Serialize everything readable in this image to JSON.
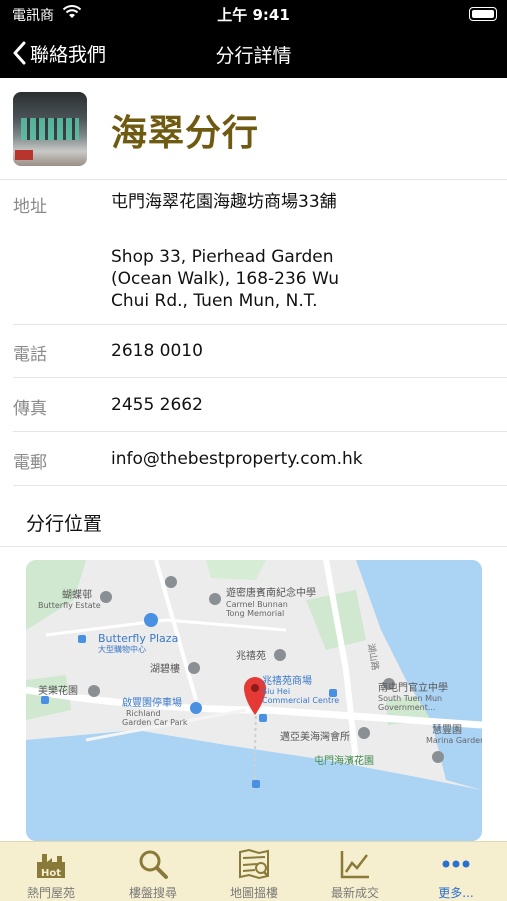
{
  "status_bar": {
    "carrier": "電訊商",
    "time": "上午 9:41"
  },
  "nav": {
    "back_label": "聯絡我們",
    "title": "分行詳情"
  },
  "branch": {
    "name": "海翠分行",
    "details": [
      {
        "label": "地址",
        "values": [
          "屯門海翠花園海趣坊商場33舖",
          "Shop 33, Pierhead Garden (Ocean Walk), 168-236 Wu Chui Rd., Tuen Mun, N.T."
        ]
      },
      {
        "label": "電話",
        "values": [
          "2618 0010"
        ]
      },
      {
        "label": "傳真",
        "values": [
          "2455 2662"
        ]
      },
      {
        "label": "電郵",
        "values": [
          "info@thebestproperty.com.hk"
        ]
      }
    ]
  },
  "location": {
    "section_title": "分行位置"
  },
  "map": {
    "labels": {
      "butterfly_estate_cn": "蝴蝶邨",
      "butterfly_estate_en": "Butterfly Estate",
      "memorial_cn": "遊密唐賓南紀念中學",
      "memorial_en_1": "Carmel Bunnan",
      "memorial_en_2": "Tong Memorial",
      "butterfly_plaza_en": "Butterfly Plaza",
      "butterfly_plaza_cn": "大型購物中心",
      "wu_king": "湖碧樓",
      "siu_hei_cn": "兆禧苑",
      "siu_hei_mall_cn": "兆禧苑商場",
      "siu_hei_mall_en_1": "Siu Hei",
      "siu_hei_mall_en_2": "Commercial Centre",
      "tm_govt_cn": "南屯門官立中學",
      "tm_govt_en_1": "South Tuen Mun",
      "tm_govt_en_2": "Government...",
      "mei_lok": "美樂花園",
      "richland_cn": "啟豐園停車場",
      "richland_en_1": "Richland",
      "richland_en_2": "Garden Car Park",
      "marina_cn": "慧豐園",
      "marina_en": "Marina Garden",
      "club": "邁亞美海灣會所",
      "promenade": "屯門海濱花園",
      "road": "湖山路"
    }
  },
  "tabs": [
    {
      "label": "熱門屋苑",
      "icon": "hot-estates-icon",
      "active": false
    },
    {
      "label": "樓盤搜尋",
      "icon": "search-icon",
      "active": false
    },
    {
      "label": "地圖搵樓",
      "icon": "map-search-icon",
      "active": false
    },
    {
      "label": "最新成交",
      "icon": "chart-icon",
      "active": false
    },
    {
      "label": "更多...",
      "icon": "more-icon",
      "active": true
    }
  ],
  "colors": {
    "accent": "#6e5a10",
    "tab_active": "#2a6fd1",
    "tab_bar": "#f6efcf",
    "nav_bg": "#000000"
  }
}
